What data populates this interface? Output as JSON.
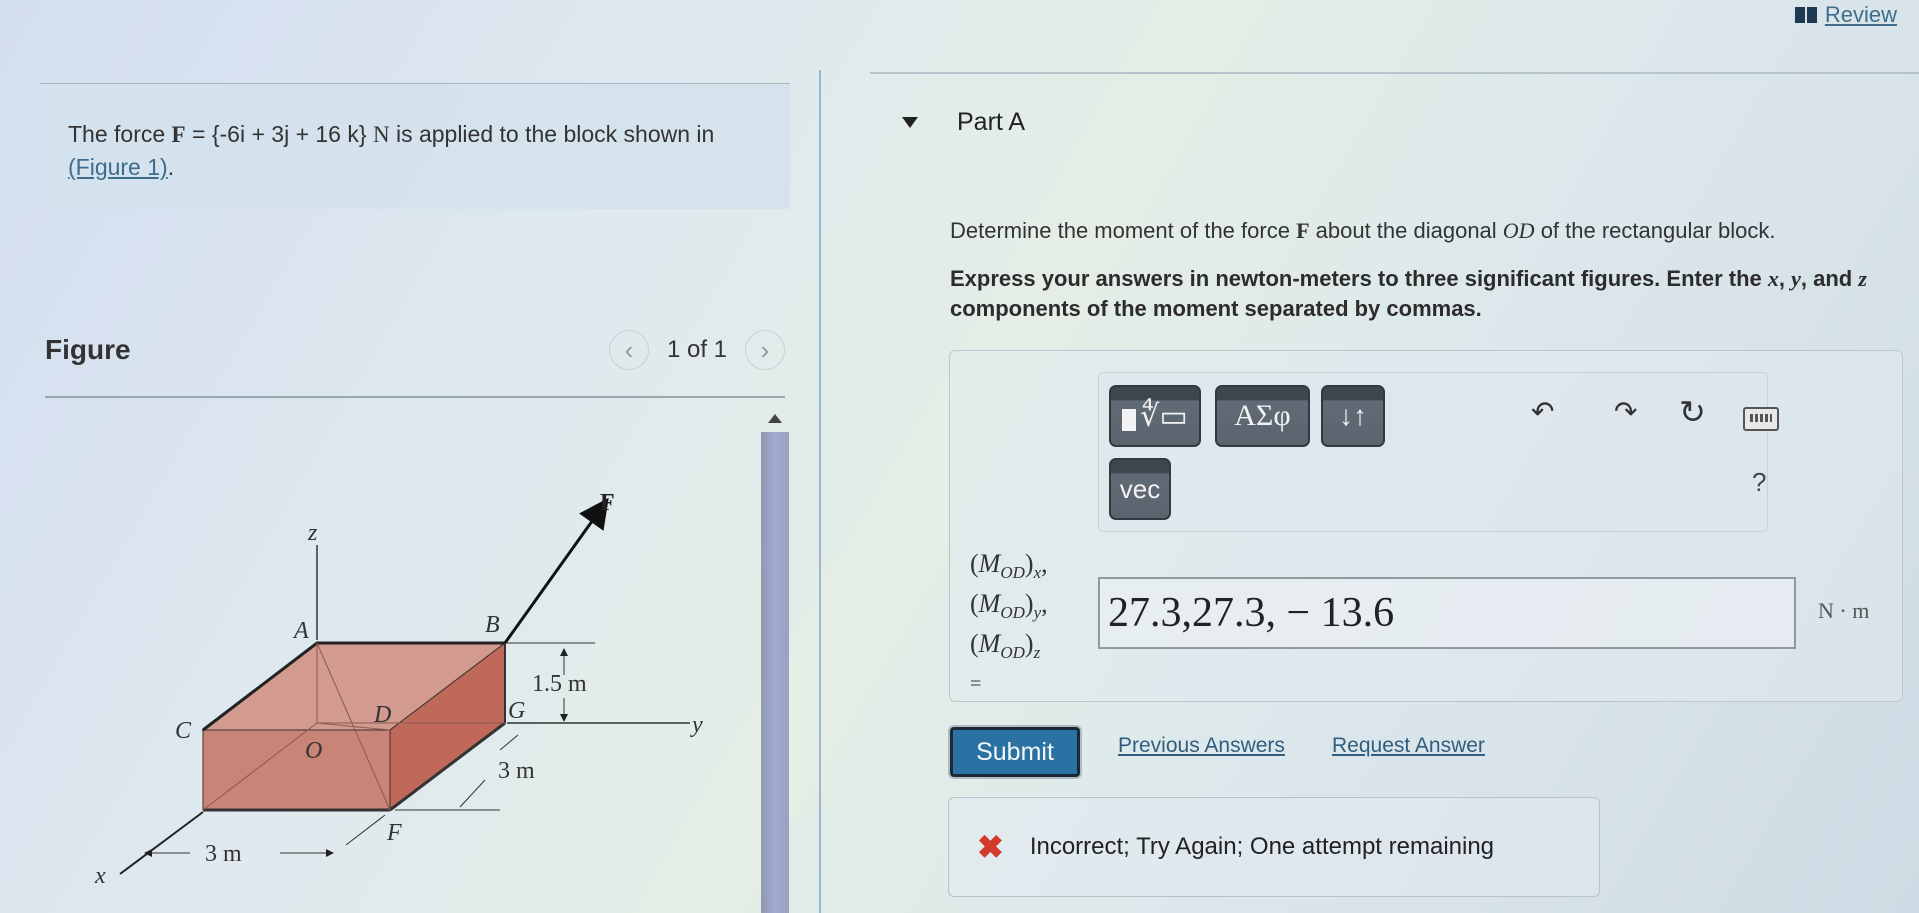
{
  "header": {
    "review_label": "Review",
    "review_icon": "book-icon"
  },
  "problem": {
    "text_prefix": "The force ",
    "force_symbol": "F",
    "force_expr": " = {-6i + 3j + 16 k} ",
    "force_unit": "N",
    "text_suffix": " is applied to the block shown in ",
    "figure_link": "(Figure 1)",
    "text_end": "."
  },
  "figure": {
    "title": "Figure",
    "counter": "1 of 1",
    "prev_icon": "chevron-left-icon",
    "next_icon": "chevron-right-icon",
    "labels": {
      "z": "z",
      "x": "x",
      "y": "y",
      "F": "F",
      "A": "A",
      "B": "B",
      "C": "C",
      "D": "D",
      "O": "O",
      "G": "G",
      "Fpt": "F",
      "dim_height": "1.5 m",
      "dim_depth": "3 m",
      "dim_width": "3 m"
    },
    "block_color": "#c98377"
  },
  "part": {
    "title": "Part A",
    "question_prefix": "Determine the moment of the force ",
    "question_force": "F",
    "question_mid": " about the diagonal ",
    "question_diag": "OD",
    "question_suffix": " of the rectangular block.",
    "instructions_a": "Express your answers in newton-meters to three significant figures. Enter the ",
    "instructions_x": "x",
    "instructions_b": ", ",
    "instructions_y": "y",
    "instructions_c": ", and ",
    "instructions_z": "z",
    "instructions_d": " components of the moment separated by commas."
  },
  "toolbar": {
    "math_button": "templates",
    "greek_label": "ΑΣφ",
    "arrows_label": "↓↑",
    "vec_label": "vec",
    "undo_icon": "undo-icon",
    "redo_icon": "redo-icon",
    "reset_icon": "reset-icon",
    "keyboard_icon": "keyboard-icon",
    "help_label": "?"
  },
  "answer": {
    "label_lines": [
      "(M",
      "OD",
      ")x,",
      "(M",
      "OD",
      ")y,",
      "(M",
      "OD",
      ")z",
      "="
    ],
    "label_x": "x",
    "label_y": "y",
    "label_z": "z",
    "label_M": "M",
    "label_OD": "OD",
    "equals": "=",
    "value": "27.3,27.3, − 13.6",
    "unit": "N · m"
  },
  "actions": {
    "submit_label": "Submit",
    "previous_answers": "Previous Answers",
    "request_answer": "Request Answer"
  },
  "feedback": {
    "icon": "✖",
    "text": "Incorrect; Try Again; One attempt remaining",
    "color": "#d33a2b"
  },
  "colors": {
    "accent": "#2a72a4",
    "link": "#2f5e80",
    "error": "#d33a2b"
  }
}
